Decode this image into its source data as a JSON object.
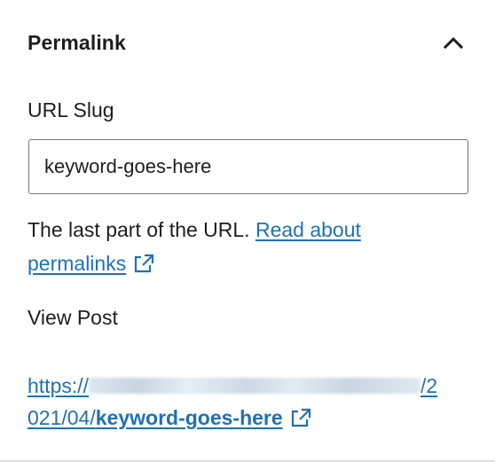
{
  "panel": {
    "title": "Permalink",
    "expanded": true,
    "chevron_icon": "chevron-up-icon"
  },
  "url_slug": {
    "label": "URL Slug",
    "value": "keyword-goes-here"
  },
  "help": {
    "text": "The last part of the URL. ",
    "link_text_line1": "Read about",
    "link_text_line2": "permalinks",
    "link_icon": "external-link-icon"
  },
  "view_post": {
    "label": "View Post",
    "url_prefix": "https://",
    "url_middle_tail": "/2",
    "url_line2": "021/04/",
    "url_slug": "keyword-goes-here",
    "link_icon": "external-link-icon"
  },
  "colors": {
    "link": "#2271b1",
    "text": "#1e1e1e",
    "input_border": "#757575"
  }
}
